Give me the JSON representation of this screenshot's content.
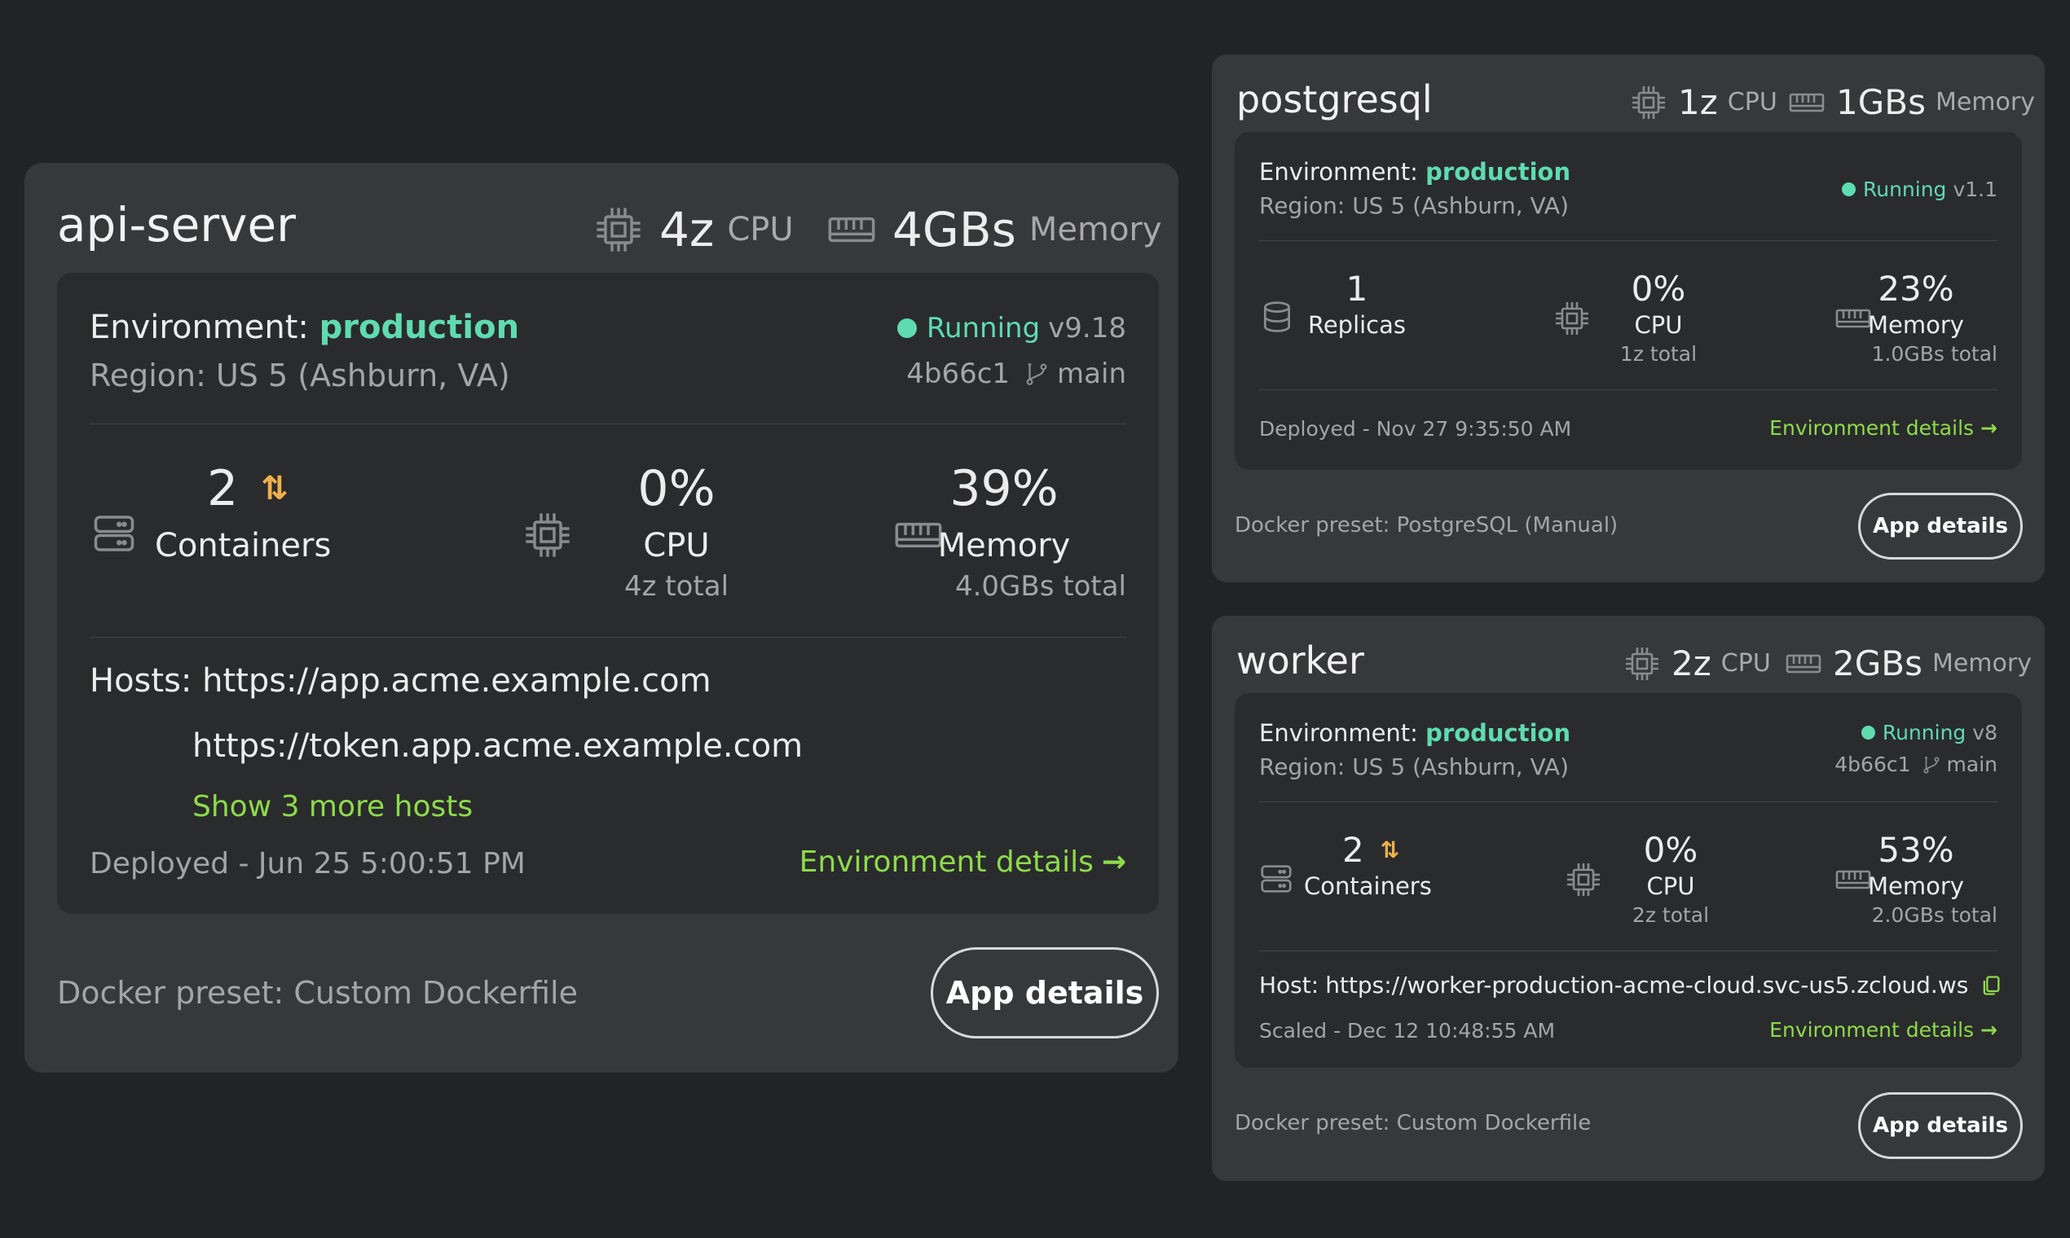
{
  "api": {
    "title": "api-server",
    "cpu_value": "4z",
    "cpu_unit": "CPU",
    "mem_value": "4GBs",
    "mem_unit": "Memory",
    "env_label": "Environment:",
    "env_value": "production",
    "region": "Region: US 5 (Ashburn, VA)",
    "status": "Running",
    "version": "v9.18",
    "commit": "4b66c1",
    "branch": "main",
    "containers_count": "2",
    "containers_label": "Containers",
    "cpu_pct": "0%",
    "cpu_label": "CPU",
    "cpu_total": "4z total",
    "mem_pct": "39%",
    "mem_label": "Memory",
    "mem_total": "4.0GBs total",
    "hosts_label": "Hosts:",
    "host1": "https://app.acme.example.com",
    "host2": "https://token.app.acme.example.com",
    "more_hosts": "Show 3 more hosts",
    "deployed": "Deployed - Jun 25 5:00:51 PM",
    "env_details": "Environment details",
    "preset": "Docker preset: Custom Dockerfile",
    "app_details": "App details"
  },
  "postgres": {
    "title": "postgresql",
    "cpu_value": "1z",
    "cpu_unit": "CPU",
    "mem_value": "1GBs",
    "mem_unit": "Memory",
    "env_label": "Environment:",
    "env_value": "production",
    "region": "Region: US 5 (Ashburn, VA)",
    "status": "Running",
    "version": "v1.1",
    "replicas_count": "1",
    "replicas_label": "Replicas",
    "cpu_pct": "0%",
    "cpu_label": "CPU",
    "cpu_total": "1z total",
    "mem_pct": "23%",
    "mem_label": "Memory",
    "mem_total": "1.0GBs total",
    "deployed": "Deployed - Nov 27 9:35:50 AM",
    "env_details": "Environment details",
    "preset": "Docker preset: PostgreSQL (Manual)",
    "app_details": "App details"
  },
  "worker": {
    "title": "worker",
    "cpu_value": "2z",
    "cpu_unit": "CPU",
    "mem_value": "2GBs",
    "mem_unit": "Memory",
    "env_label": "Environment:",
    "env_value": "production",
    "region": "Region: US 5 (Ashburn, VA)",
    "status": "Running",
    "version": "v8",
    "commit": "4b66c1",
    "branch": "main",
    "containers_count": "2",
    "containers_label": "Containers",
    "cpu_pct": "0%",
    "cpu_label": "CPU",
    "cpu_total": "2z total",
    "mem_pct": "53%",
    "mem_label": "Memory",
    "mem_total": "2.0GBs total",
    "host_label": "Host:",
    "host": "https://worker-production-acme-cloud.svc-us5.zcloud.ws",
    "scaled": "Scaled - Dec 12 10:48:55 AM",
    "env_details": "Environment details",
    "preset": "Docker preset: Custom Dockerfile",
    "app_details": "App details"
  },
  "icons": {
    "cpu": "cpu-chip-icon",
    "memory": "memory-module-icon",
    "containers": "server-stack-icon",
    "replicas": "database-icon",
    "scale": "up-down-arrows-icon",
    "branch": "git-branch-icon",
    "arrow": "arrow-right-icon",
    "copy": "copy-icon"
  },
  "colors": {
    "background": "#222325",
    "card": "#37383a",
    "inner": "#2a2b2d",
    "production": "#5fdbb0",
    "running": "#5fdbb0",
    "link": "#8edb4a",
    "scale_arrows": "#f2b04a"
  }
}
